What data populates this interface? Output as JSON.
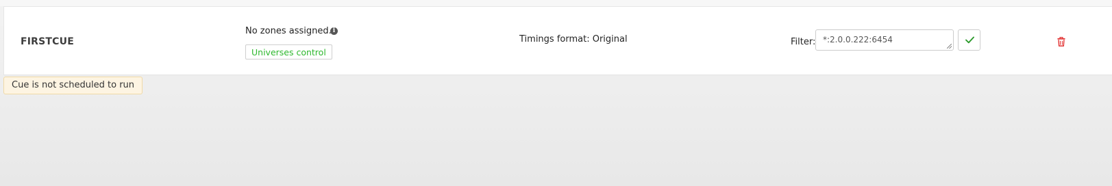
{
  "cue": {
    "name": "FIRSTCUE",
    "zones_text": "No zones assigned.",
    "info_icon": "info-circle-icon",
    "universes_button_label": "Universes control",
    "timings_text": "Timings format: Original",
    "filter_label": "Filter:",
    "filter_value": "*:2.0.0.222:6454",
    "apply_icon": "check-icon",
    "delete_icon": "trash-icon",
    "info_glyph": "i"
  },
  "status": {
    "message": "Cue is not scheduled to run"
  },
  "colors": {
    "accent_green": "#2eb82e",
    "delete_red": "#e02424",
    "banner_background": "#fdf4e2",
    "banner_border": "#f0d9a6"
  }
}
